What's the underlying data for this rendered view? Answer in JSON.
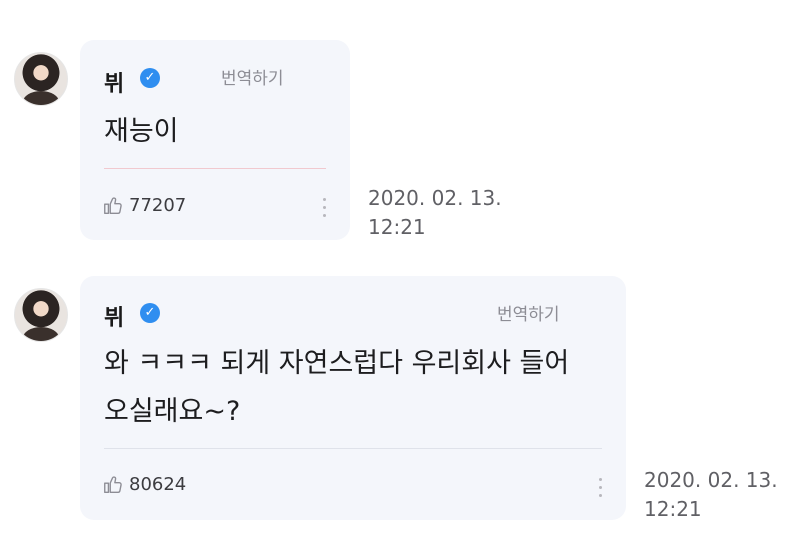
{
  "comments": [
    {
      "author": "뷔",
      "translate_label": "번역하기",
      "message_lines": [
        "재능이"
      ],
      "likes": "77207",
      "date": "2020. 02. 13.",
      "time": "12:21"
    },
    {
      "author": "뷔",
      "translate_label": "번역하기",
      "message_lines": [
        "와 ㅋㅋㅋ 되게 자연스럽다 우리회사 들어",
        "오실래요~?"
      ],
      "likes": "80624",
      "date": "2020. 02. 13.",
      "time": "12:21"
    }
  ],
  "icons": {
    "verified": "verified-badge-icon",
    "like": "thumbs-up-icon",
    "more": "more-vertical-icon"
  },
  "colors": {
    "bubble": "#f4f6fb",
    "verified": "#2f8ef0",
    "divider_1": "#f1c9cf",
    "divider_2": "#dfe2ea"
  }
}
